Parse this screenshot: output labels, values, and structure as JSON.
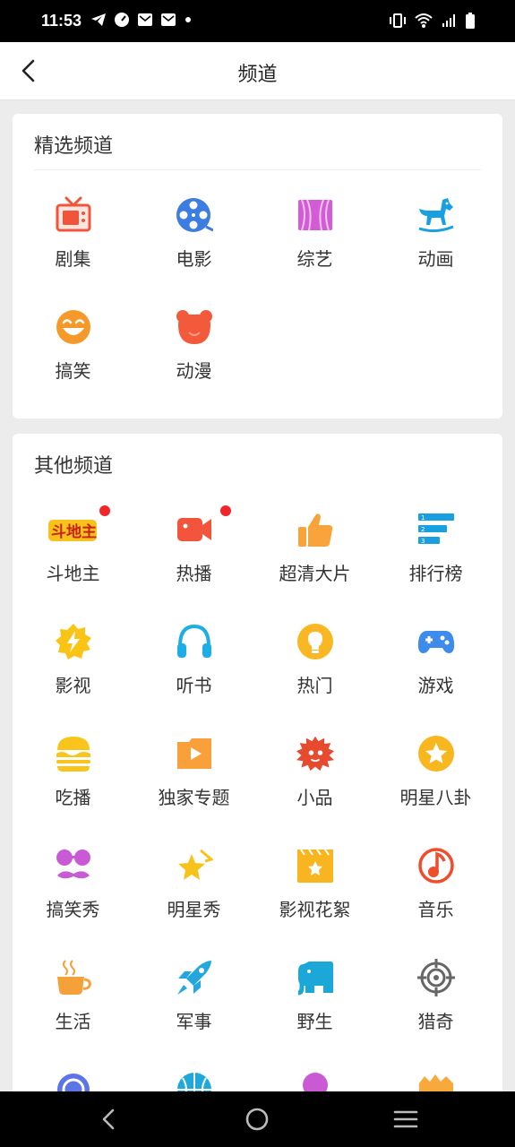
{
  "status_bar": {
    "time": "11:53"
  },
  "header": {
    "title": "频道"
  },
  "featured": {
    "title": "精选频道",
    "items": [
      {
        "label": "剧集",
        "icon": "tv-icon"
      },
      {
        "label": "电影",
        "icon": "film-reel-icon"
      },
      {
        "label": "综艺",
        "icon": "stage-curtain-icon"
      },
      {
        "label": "动画",
        "icon": "rocking-horse-icon"
      },
      {
        "label": "搞笑",
        "icon": "laughing-face-icon"
      },
      {
        "label": "动漫",
        "icon": "bear-head-icon"
      }
    ]
  },
  "others": {
    "title": "其他频道",
    "items": [
      {
        "label": "斗地主",
        "icon": "doudizhu-logo-icon",
        "badge": true
      },
      {
        "label": "热播",
        "icon": "video-camera-icon",
        "badge": true
      },
      {
        "label": "超清大片",
        "icon": "thumbs-up-icon"
      },
      {
        "label": "排行榜",
        "icon": "ranking-list-icon"
      },
      {
        "label": "影视",
        "icon": "lightning-badge-icon"
      },
      {
        "label": "听书",
        "icon": "headphones-icon"
      },
      {
        "label": "热门",
        "icon": "lightbulb-icon"
      },
      {
        "label": "游戏",
        "icon": "gamepad-icon"
      },
      {
        "label": "吃播",
        "icon": "burger-icon"
      },
      {
        "label": "独家专题",
        "icon": "play-folder-icon"
      },
      {
        "label": "小品",
        "icon": "hedgehog-icon"
      },
      {
        "label": "明星八卦",
        "icon": "star-circle-icon"
      },
      {
        "label": "搞笑秀",
        "icon": "glasses-mustache-icon"
      },
      {
        "label": "明星秀",
        "icon": "shooting-star-icon"
      },
      {
        "label": "影视花絮",
        "icon": "clapperboard-icon"
      },
      {
        "label": "音乐",
        "icon": "music-note-icon"
      },
      {
        "label": "生活",
        "icon": "coffee-cup-icon"
      },
      {
        "label": "军事",
        "icon": "rocket-icon"
      },
      {
        "label": "野生",
        "icon": "elephant-icon"
      },
      {
        "label": "猎奇",
        "icon": "crosshair-icon"
      },
      {
        "label": "",
        "icon": "blue-ring-icon"
      },
      {
        "label": "",
        "icon": "basketball-icon"
      },
      {
        "label": "",
        "icon": "purple-circle-icon"
      },
      {
        "label": "",
        "icon": "orange-cloud-icon"
      }
    ]
  },
  "colors": {
    "badge": "#f0262b",
    "background": "#ececec"
  }
}
